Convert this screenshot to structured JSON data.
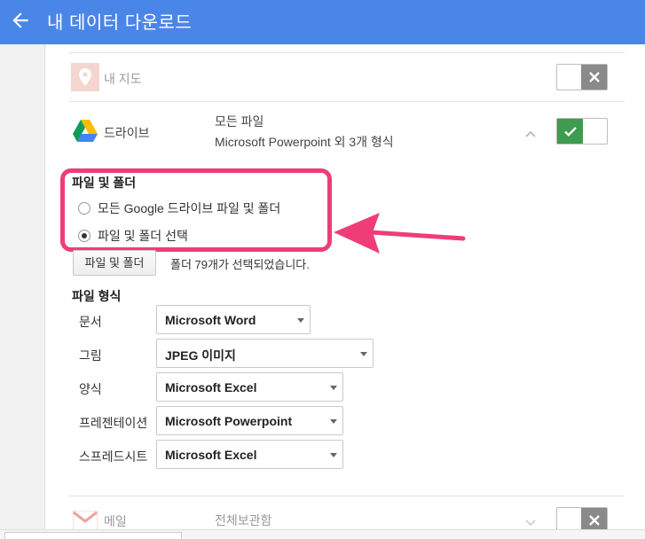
{
  "header": {
    "title": "내 데이터 다운로드",
    "back_icon": "arrow-back-icon"
  },
  "services": {
    "maps": {
      "name": "내 지도",
      "enabled": false,
      "icon": "maps-pin-icon"
    },
    "drive": {
      "name": "드라이브",
      "icon": "drive-logo-icon",
      "scope": "모든 파일",
      "formats_summary": "Microsoft Powerpoint 외 3개 형식",
      "enabled": true,
      "expanded": true
    },
    "mail": {
      "name": "메일",
      "scope": "전체보관함",
      "enabled": false,
      "icon": "gmail-logo-icon"
    }
  },
  "drive_options": {
    "files_folders_title": "파일 및 폴더",
    "radio_all": "모든 Google 드라이브 파일 및 폴더",
    "radio_select": "파일 및 폴더 선택",
    "selected_option": "radio_select",
    "select_button": "파일 및 폴더",
    "selection_note": "폴더 79개가 선택되었습니다."
  },
  "file_formats": {
    "title": "파일 형식",
    "rows": [
      {
        "label": "문서",
        "value": "Microsoft Word"
      },
      {
        "label": "그림",
        "value": "JPEG 이미지"
      },
      {
        "label": "양식",
        "value": "Microsoft Excel"
      },
      {
        "label": "프레젠테이션",
        "value": "Microsoft Powerpoint"
      },
      {
        "label": "스프레드시트",
        "value": "Microsoft Excel"
      }
    ]
  },
  "colors": {
    "header": "#4a86e8",
    "highlight": "#ef3d77",
    "toggle_on": "#3d9c4f",
    "toggle_off": "#8a8a8a"
  }
}
